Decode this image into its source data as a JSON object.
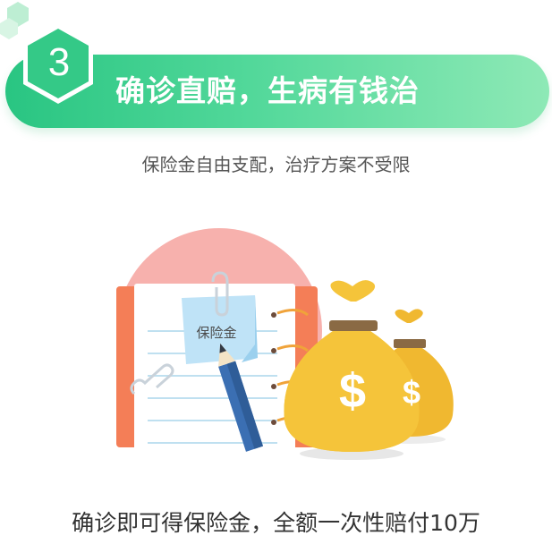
{
  "header": {
    "step_number": "3",
    "title": "确诊直赔，生病有钱治"
  },
  "subtitle": "保险金自由支配，治疗方案不受限",
  "illustration": {
    "note_label": "保险金",
    "currency_symbol": "$"
  },
  "footer_text": "确诊即可得保险金，全额一次性赔付10万",
  "colors": {
    "banner_start": "#29c582",
    "banner_end": "#8ee9b6",
    "accent_pink": "#f7b1ad",
    "notebook_orange": "#f47e57",
    "bag_gold": "#f5c43a",
    "bag_band": "#8a6a44",
    "pencil_blue": "#3b6fb3",
    "note_blue": "#bfe3f7"
  }
}
